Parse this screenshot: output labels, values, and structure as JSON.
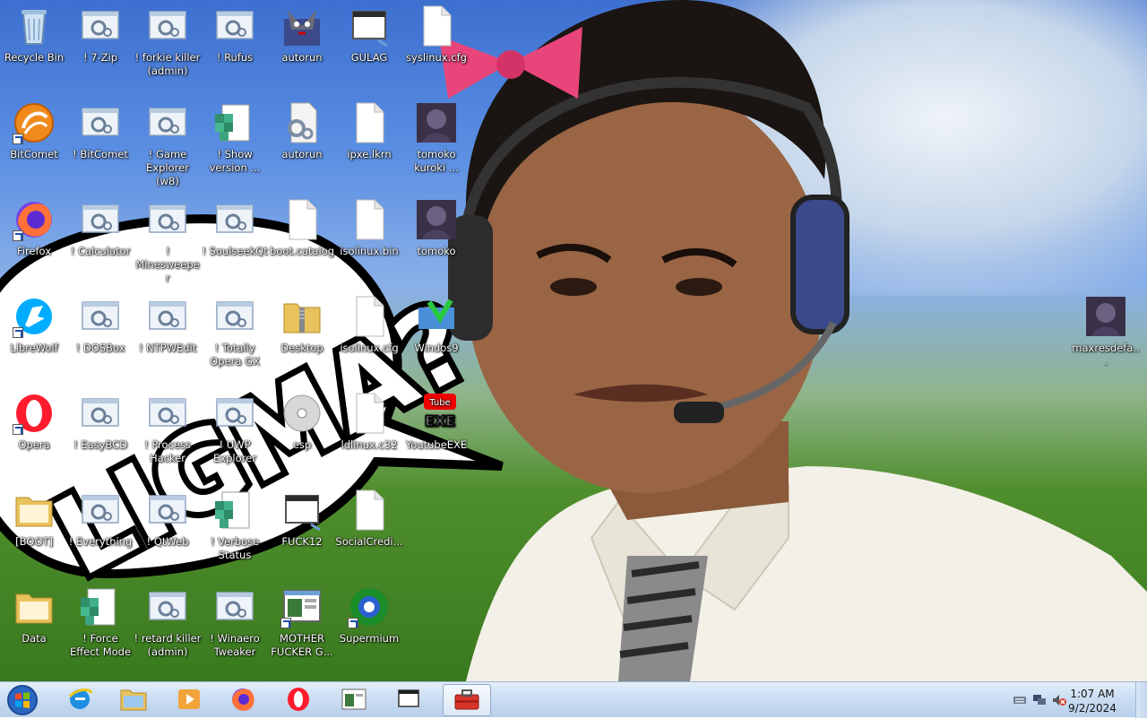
{
  "desktop": {
    "icons": [
      {
        "label": "Recycle Bin",
        "icon": "recycle-bin-icon"
      },
      {
        "label": "! 7-Zip",
        "icon": "script-icon"
      },
      {
        "label": "! forkie killer (admin)",
        "icon": "script-icon"
      },
      {
        "label": "! Rufus",
        "icon": "script-icon"
      },
      {
        "label": "autorun",
        "icon": "autorun-icon"
      },
      {
        "label": "GULAG",
        "icon": "window-icon"
      },
      {
        "label": "syslinux.cfg",
        "icon": "file-icon"
      },
      {
        "label": "BitComet",
        "icon": "bitcomet-icon"
      },
      {
        "label": "! BitComet",
        "icon": "script-icon"
      },
      {
        "label": "! Game Explorer (w8)",
        "icon": "script-icon"
      },
      {
        "label": "! Show version ...",
        "icon": "registry-icon"
      },
      {
        "label": "autorun",
        "icon": "settings-file-icon"
      },
      {
        "label": "ipxe.lkrn",
        "icon": "file-icon"
      },
      {
        "label": "tomoko kuroki ...",
        "icon": "image-icon"
      },
      {
        "label": "Firefox",
        "icon": "firefox-icon"
      },
      {
        "label": "! Calculator",
        "icon": "script-icon"
      },
      {
        "label": "! Minesweeper",
        "icon": "script-icon"
      },
      {
        "label": "! SoulseekQt",
        "icon": "script-icon"
      },
      {
        "label": "boot.catalog",
        "icon": "file-icon"
      },
      {
        "label": "isolinux.bin",
        "icon": "file-icon"
      },
      {
        "label": "tomoko",
        "icon": "image-icon"
      },
      {
        "label": "LibreWolf",
        "icon": "librewolf-icon"
      },
      {
        "label": "! DOSBox",
        "icon": "script-icon"
      },
      {
        "label": "! NTPWEdit",
        "icon": "script-icon"
      },
      {
        "label": "! Totally Opera GX",
        "icon": "script-icon"
      },
      {
        "label": "Desktop",
        "icon": "zip-folder-icon"
      },
      {
        "label": "isolinux.cfg",
        "icon": "file-icon"
      },
      {
        "label": "Windos9",
        "icon": "windos-icon"
      },
      {
        "label": "Opera",
        "icon": "opera-icon"
      },
      {
        "label": "! EasyBCD",
        "icon": "script-icon"
      },
      {
        "label": "! Process Hacker",
        "icon": "script-icon"
      },
      {
        "label": "! UWP Explorer",
        "icon": "script-icon"
      },
      {
        "label": "esp",
        "icon": "disc-icon"
      },
      {
        "label": "ldlinux.c32",
        "icon": "file-icon"
      },
      {
        "label": "YoutubeEXE",
        "icon": "youtube-icon"
      },
      {
        "label": "[BOOT]",
        "icon": "folder-icon"
      },
      {
        "label": "! Everything",
        "icon": "script-icon"
      },
      {
        "label": "! QtWeb",
        "icon": "script-icon"
      },
      {
        "label": "! Verbose Status",
        "icon": "registry-icon"
      },
      {
        "label": "FUCK12",
        "icon": "window-icon"
      },
      {
        "label": "SocialCredi...",
        "icon": "file-icon"
      },
      {
        "label": "Data",
        "icon": "folder-icon"
      },
      {
        "label": "! Force Effect Mode",
        "icon": "registry-icon"
      },
      {
        "label": "! retard killer (admin)",
        "icon": "script-icon"
      },
      {
        "label": "! Winaero Tweaker",
        "icon": "script-icon"
      },
      {
        "label": "MOTHER FUCKER G...",
        "icon": "app-window-icon"
      },
      {
        "label": "Supermium",
        "icon": "supermium-icon"
      },
      {
        "label": "maxresdefa...",
        "icon": "image-icon"
      }
    ],
    "wallpaper_bubble_text": "LIGMA?"
  },
  "taskbar": {
    "start": {
      "icon": "windows-start-icon"
    },
    "pinned": [
      {
        "name": "internet-explorer",
        "icon": "internet-explorer-icon"
      },
      {
        "name": "file-explorer",
        "icon": "folder-icon"
      },
      {
        "name": "media-player",
        "icon": "media-player-icon"
      },
      {
        "name": "firefox",
        "icon": "firefox-icon"
      },
      {
        "name": "opera",
        "icon": "opera-icon"
      },
      {
        "name": "app-window",
        "icon": "app-window-icon"
      },
      {
        "name": "window",
        "icon": "window-icon"
      },
      {
        "name": "toolbox",
        "icon": "toolbox-icon",
        "active": true
      }
    ],
    "tray": {
      "icons": [
        "keyboard-icon",
        "network-icon",
        "volume-muted-icon"
      ],
      "time": "1:07 AM",
      "date": "9/2/2024"
    }
  },
  "colors": {
    "taskbar": "#c9dcf2",
    "label_text": "#ffffff"
  }
}
